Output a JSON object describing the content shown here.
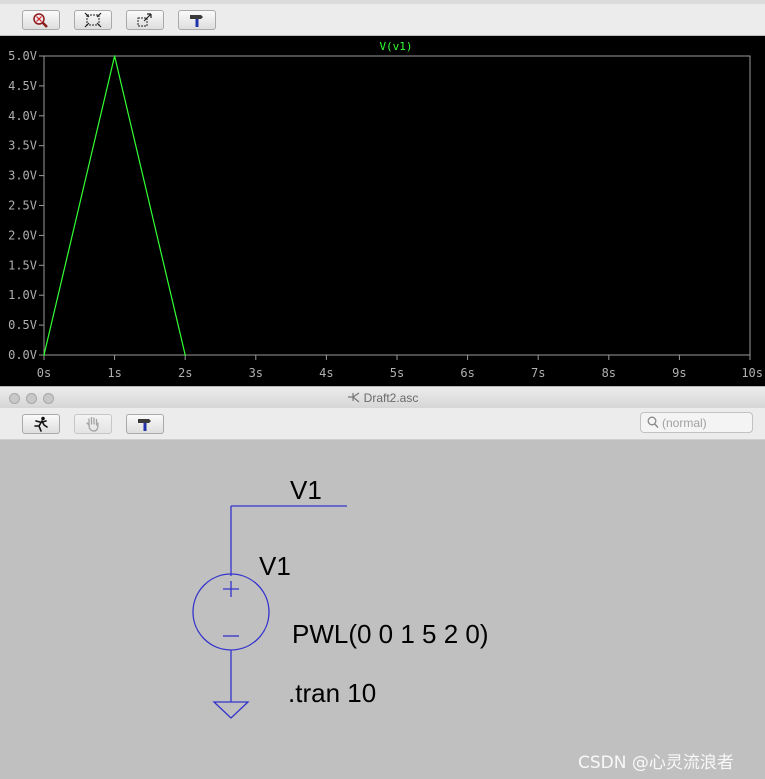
{
  "plot_window": {
    "toolbar": {
      "buttons": [
        {
          "name": "zoom-full-button",
          "icon": "zoom-full-icon"
        },
        {
          "name": "zoom-area-button",
          "icon": "zoom-area-icon"
        },
        {
          "name": "zoom-back-button",
          "icon": "zoom-back-icon"
        },
        {
          "name": "autorange-button",
          "icon": "hammer-icon"
        }
      ]
    }
  },
  "chart_data": {
    "type": "line",
    "title": "V(v1)",
    "xlabel": "",
    "ylabel": "",
    "x_ticks": [
      "0s",
      "1s",
      "2s",
      "3s",
      "4s",
      "5s",
      "6s",
      "7s",
      "8s",
      "9s",
      "10s"
    ],
    "y_ticks": [
      "0.0V",
      "0.5V",
      "1.0V",
      "1.5V",
      "2.0V",
      "2.5V",
      "3.0V",
      "3.5V",
      "4.0V",
      "4.5V",
      "5.0V"
    ],
    "xlim": [
      0,
      10
    ],
    "ylim": [
      0,
      5
    ],
    "grid": false,
    "series": [
      {
        "name": "V(v1)",
        "color": "#33ff33",
        "x": [
          0,
          1,
          2
        ],
        "y": [
          0,
          5,
          0
        ]
      }
    ],
    "colors": {
      "background": "#000000",
      "frame": "#9a9a9a",
      "tick_label": "#b0b0b0"
    }
  },
  "schematic_window": {
    "title": "Draft2.asc",
    "toolbar": {
      "buttons": [
        {
          "name": "run-button",
          "icon": "running-man-icon",
          "enabled": true
        },
        {
          "name": "halt-button",
          "icon": "hand-icon",
          "enabled": false
        },
        {
          "name": "autorange-button",
          "icon": "hammer-icon",
          "enabled": true
        }
      ]
    },
    "search": {
      "placeholder": "(normal)",
      "value": ""
    },
    "schematic": {
      "net_label": "V1",
      "source_name": "V1",
      "source_value": "PWL(0 0 1 5 2 0)",
      "directive": ".tran 10",
      "wire_color": "#3333cc",
      "text_color": "#000000"
    }
  },
  "watermark": "CSDN @心灵流浪者"
}
